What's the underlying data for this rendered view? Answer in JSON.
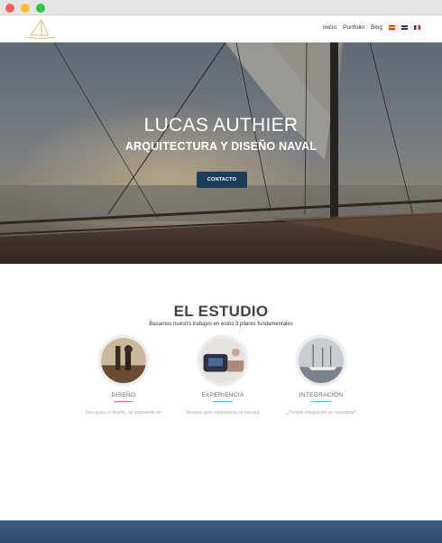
{
  "nav": {
    "links": [
      "Inicio",
      "Portfolio",
      "Blog"
    ],
    "languages": [
      "es",
      "en",
      "fr"
    ]
  },
  "hero": {
    "title": "LUCAS AUTHIER",
    "subtitle": "ARQUITECTURA Y DISEÑO NAVAL",
    "button_label": "CONTACTO"
  },
  "estudio": {
    "title": "EL ESTUDIO",
    "subtitle": "Basamos nuestro trabajos en estos 3 pilares fundamentales",
    "pillars": [
      {
        "label": "DISEÑO",
        "text": "Nos gusta el diseño, no solamente de",
        "accent": "#e07b6a"
      },
      {
        "label": "EXPERIENCIA",
        "text": "Nuestra gran experiencia es nuestra",
        "accent": "#5ab0d6"
      },
      {
        "label": "INTEGRACIÓN",
        "text": "¿Porque integración es necesaria?",
        "accent": "#5ab0d6"
      }
    ]
  },
  "colors": {
    "button": "#1e3b5d",
    "bottom_band": "#3c5a80"
  }
}
